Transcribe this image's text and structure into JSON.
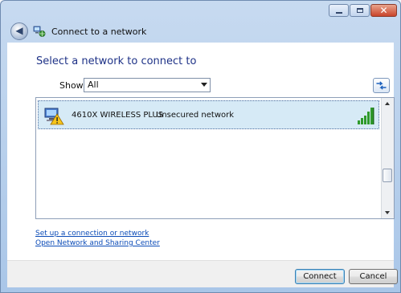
{
  "window": {
    "title": "Connect to a network",
    "controls": {
      "minimize_icon": "minimize-icon",
      "maximize_icon": "maximize-icon",
      "close_icon": "close-icon",
      "close_glyph": "✕"
    },
    "back_glyph": "◀"
  },
  "main": {
    "heading": "Select a network to connect to",
    "filter": {
      "label": "Show",
      "value": "All"
    },
    "refresh_icon": "refresh-icon"
  },
  "networks": [
    {
      "name": "4610X WIRELESS PLUS",
      "status": "Unsecured network",
      "signal": "strong",
      "selected": true
    }
  ],
  "links": {
    "setup": "Set up a connection or network",
    "sharing_center": "Open Network and Sharing Center"
  },
  "buttons": {
    "connect": "Connect",
    "cancel": "Cancel"
  },
  "colors": {
    "heading": "#1e3287",
    "link": "#0b4bb7",
    "selected_row": "#d6eaf6",
    "signal_bar": "#2f9a2b"
  }
}
